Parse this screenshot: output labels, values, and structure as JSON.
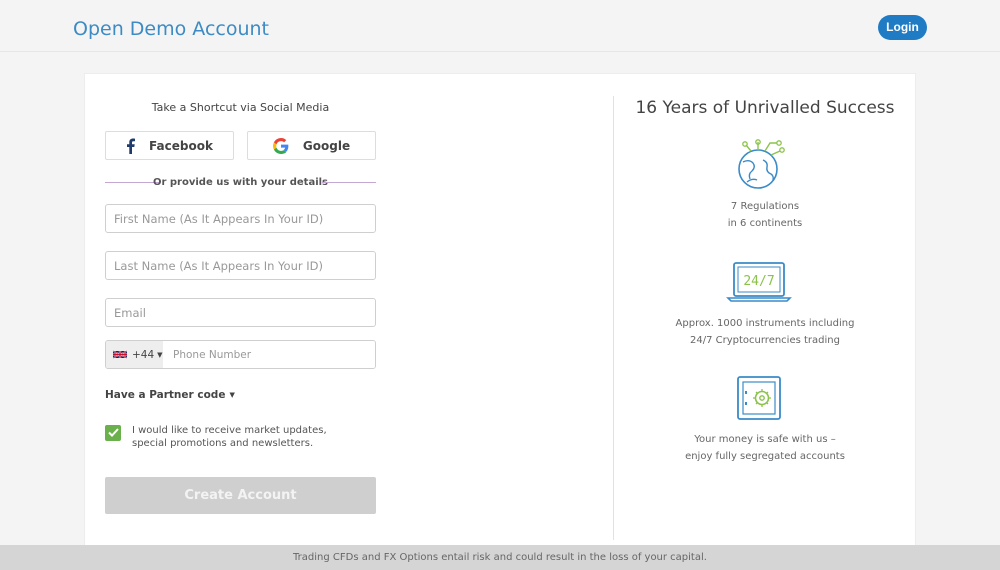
{
  "header": {
    "title": "Open Demo Account",
    "login_label": "Login"
  },
  "form": {
    "shortcut_title": "Take a Shortcut via Social Media",
    "facebook_label": "Facebook",
    "google_label": "Google",
    "divider_text": "Or provide us with your details",
    "first_name_placeholder": "First Name (As It Appears In Your ID)",
    "last_name_placeholder": "Last Name (As It Appears In Your ID)",
    "email_placeholder": "Email",
    "phone_country_code": "+44",
    "phone_placeholder": "Phone Number",
    "partner_code_label": "Have a Partner code",
    "consent_text": "I would like to receive market updates, special promotions and newsletters.",
    "consent_checked": true,
    "create_account_label": "Create Account"
  },
  "benefits": {
    "title": "16 Years of Unrivalled Success",
    "items": [
      {
        "icon": "globe-circuit-icon",
        "line1": "7 Regulations",
        "line2": "in 6 continents"
      },
      {
        "icon": "laptop-24-7-icon",
        "line1": "Approx. 1000 instruments including",
        "line2": "24/7 Cryptocurrencies trading"
      },
      {
        "icon": "safe-icon",
        "line1": "Your money is safe with us –",
        "line2": "enjoy fully segregated accounts"
      }
    ]
  },
  "laptop_screen_text": "24/7",
  "footer": {
    "disclaimer": "Trading CFDs and FX Options entail risk and could result in the loss of your capital."
  },
  "colors": {
    "accent_blue": "#1f7cc4",
    "title_blue": "#3d8bc4",
    "check_green": "#6ab04c",
    "icon_green": "#8bc34a",
    "divider_purple": "#c4a7d3"
  }
}
